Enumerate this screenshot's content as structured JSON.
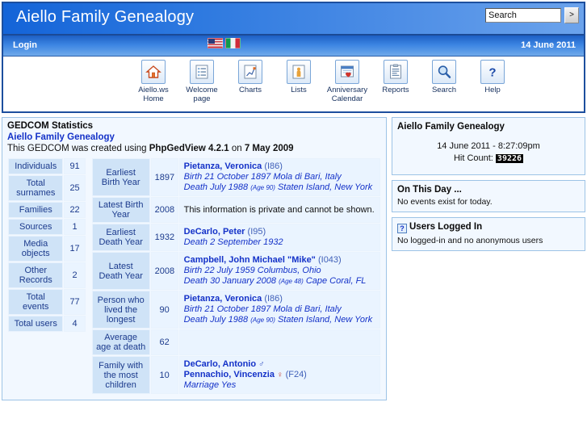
{
  "header": {
    "site_title": "Aiello Family Genealogy",
    "search": {
      "value": "Search",
      "placeholder": "Search",
      "go_label": ">"
    },
    "login_label": "Login",
    "date": "14 June 2011",
    "flags": [
      {
        "name": "flag-us",
        "title": "English"
      },
      {
        "name": "flag-it",
        "title": "Italiano"
      }
    ],
    "menu": [
      {
        "label_line1": "Aiello.ws",
        "label_line2": "Home",
        "icon": "home-icon"
      },
      {
        "label_line1": "Welcome",
        "label_line2": "page",
        "icon": "page-icon"
      },
      {
        "label_line1": "Charts",
        "label_line2": "",
        "icon": "chart-icon"
      },
      {
        "label_line1": "Lists",
        "label_line2": "",
        "icon": "person-icon"
      },
      {
        "label_line1": "Anniversary",
        "label_line2": "Calendar",
        "icon": "calendar-heart-icon"
      },
      {
        "label_line1": "Reports",
        "label_line2": "",
        "icon": "report-icon"
      },
      {
        "label_line1": "Search",
        "label_line2": "",
        "icon": "magnifier-icon"
      },
      {
        "label_line1": "Help",
        "label_line2": "",
        "icon": "question-icon"
      }
    ]
  },
  "stats": {
    "title": "GEDCOM Statistics",
    "subtitle": "Aiello Family Genealogy",
    "created_prefix": "This GEDCOM was created using ",
    "created_program": "PhpGedView 4.2.1",
    "created_mid": " on ",
    "created_date": "7 May 2009",
    "counts": [
      {
        "label": "Individuals",
        "value": "91"
      },
      {
        "label": "Total surnames",
        "value": "25"
      },
      {
        "label": "Families",
        "value": "22"
      },
      {
        "label": "Sources",
        "value": "1"
      },
      {
        "label": "Media objects",
        "value": "17"
      },
      {
        "label": "Other Records",
        "value": "2"
      },
      {
        "label": "Total events",
        "value": "77"
      },
      {
        "label": "Total users",
        "value": "4"
      }
    ],
    "records": [
      {
        "label": "Earliest Birth Year",
        "number": "1897",
        "person": "Pietanza, Veronica",
        "person_id": "(I86)",
        "facts": [
          {
            "text": "Birth 21 October 1897 Mola di Bari, Italy"
          },
          {
            "text": "Death July 1988 ",
            "age": "(Age 90)",
            "tail": " Staten Island, New York"
          }
        ]
      },
      {
        "label": "Latest Birth Year",
        "number": "2008",
        "private_text": "This information is private and cannot be shown."
      },
      {
        "label": "Earliest Death Year",
        "number": "1932",
        "person": "DeCarlo, Peter",
        "person_id": "(I95)",
        "facts": [
          {
            "text": "Death 2 September 1932"
          }
        ]
      },
      {
        "label": "Latest Death Year",
        "number": "2008",
        "person": "Campbell, John Michael \"Mike\"",
        "person_id": "(I043)",
        "facts": [
          {
            "text": "Birth 22 July 1959 Columbus, Ohio"
          },
          {
            "text": "Death 30 January 2008 ",
            "age": "(Age 48)",
            "tail": " Cape Coral, FL"
          }
        ]
      },
      {
        "label": "Person who lived the longest",
        "number": "90",
        "person": "Pietanza, Veronica",
        "person_id": "(I86)",
        "facts": [
          {
            "text": "Birth 21 October 1897 Mola di Bari, Italy"
          },
          {
            "text": "Death July 1988 ",
            "age": "(Age 90)",
            "tail": " Staten Island, New York"
          }
        ]
      },
      {
        "label": "Average age at death",
        "number": "62",
        "facts": []
      },
      {
        "label": "Family with the most children",
        "number": "10",
        "husband": "DeCarlo, Antonio",
        "husband_sex": "♂",
        "wife": "Pennachio, Vincenzia",
        "wife_sex": "♀",
        "family_id": "(F24)",
        "facts": [
          {
            "text": "Marriage Yes"
          }
        ]
      }
    ]
  },
  "sidebar": {
    "welcome": {
      "title": "Aiello Family Genealogy",
      "datetime": "14 June 2011 - 8:27:09pm",
      "hit_label": "Hit Count: ",
      "hit_count": "39226"
    },
    "on_this_day": {
      "title": "On This Day ...",
      "text": "No events exist for today."
    },
    "users_logged_in": {
      "title": "Users Logged In",
      "help_icon": "question-icon",
      "text": "No logged-in and no anonymous users"
    }
  },
  "colors": {
    "header_blue_dark": "#1464d8",
    "header_blue_light": "#6ba3ec",
    "frame_border": "#1d4f9e",
    "panel_border": "#9dc3e6",
    "panel_bg": "#f2f8ff",
    "cell_label_bg": "#cfe3f7",
    "cell_value_bg": "#eaf4ff",
    "link_blue": "#1432c8",
    "hit_count_bg": "#000000"
  }
}
